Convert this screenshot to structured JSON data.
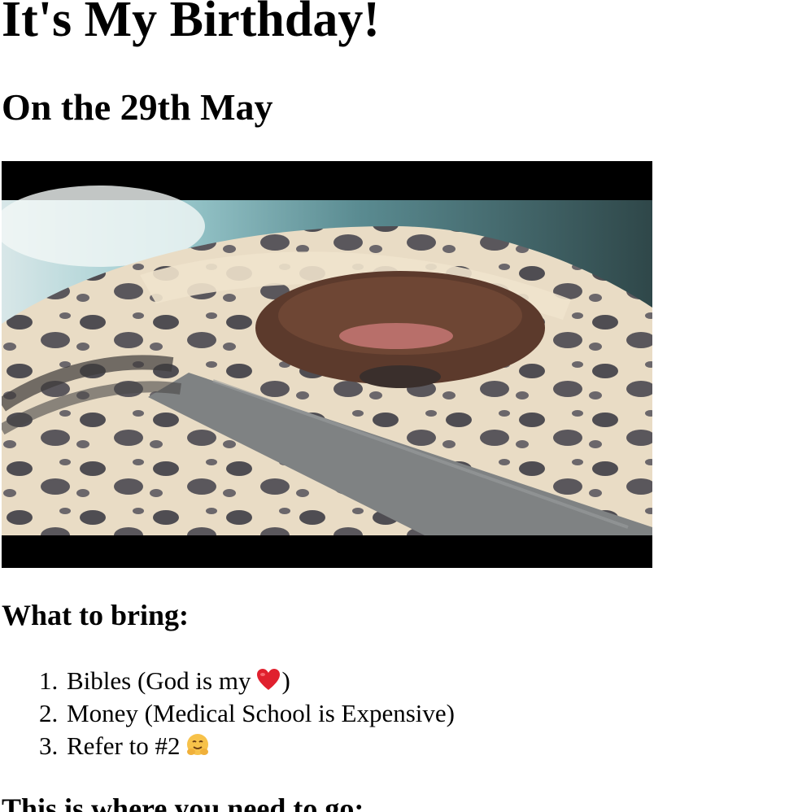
{
  "page": {
    "title": "It's My Birthday!",
    "subtitle": "On the 29th May",
    "photo": {
      "subject": "selfie of a person wearing a patterned fleece hood in a car",
      "emoji_heart": "heart-emoji",
      "emoji_hug": "hugging-face-emoji"
    },
    "bring_heading": "What to bring:",
    "bring_items": [
      {
        "number": "1.",
        "text": "Bibles (God is my",
        "suffix": ")"
      },
      {
        "number": "2.",
        "text": "Money (Medical School is Expensive)",
        "suffix": ""
      },
      {
        "number": "3.",
        "text": "Refer to #2",
        "suffix": ""
      }
    ],
    "go_heading": "This is where you need to go:"
  },
  "colors": {
    "background": "#ffffff",
    "text": "#000000",
    "letterbox": "#000000",
    "heart": "#e0202e",
    "hug_face": "#f7c24a"
  }
}
